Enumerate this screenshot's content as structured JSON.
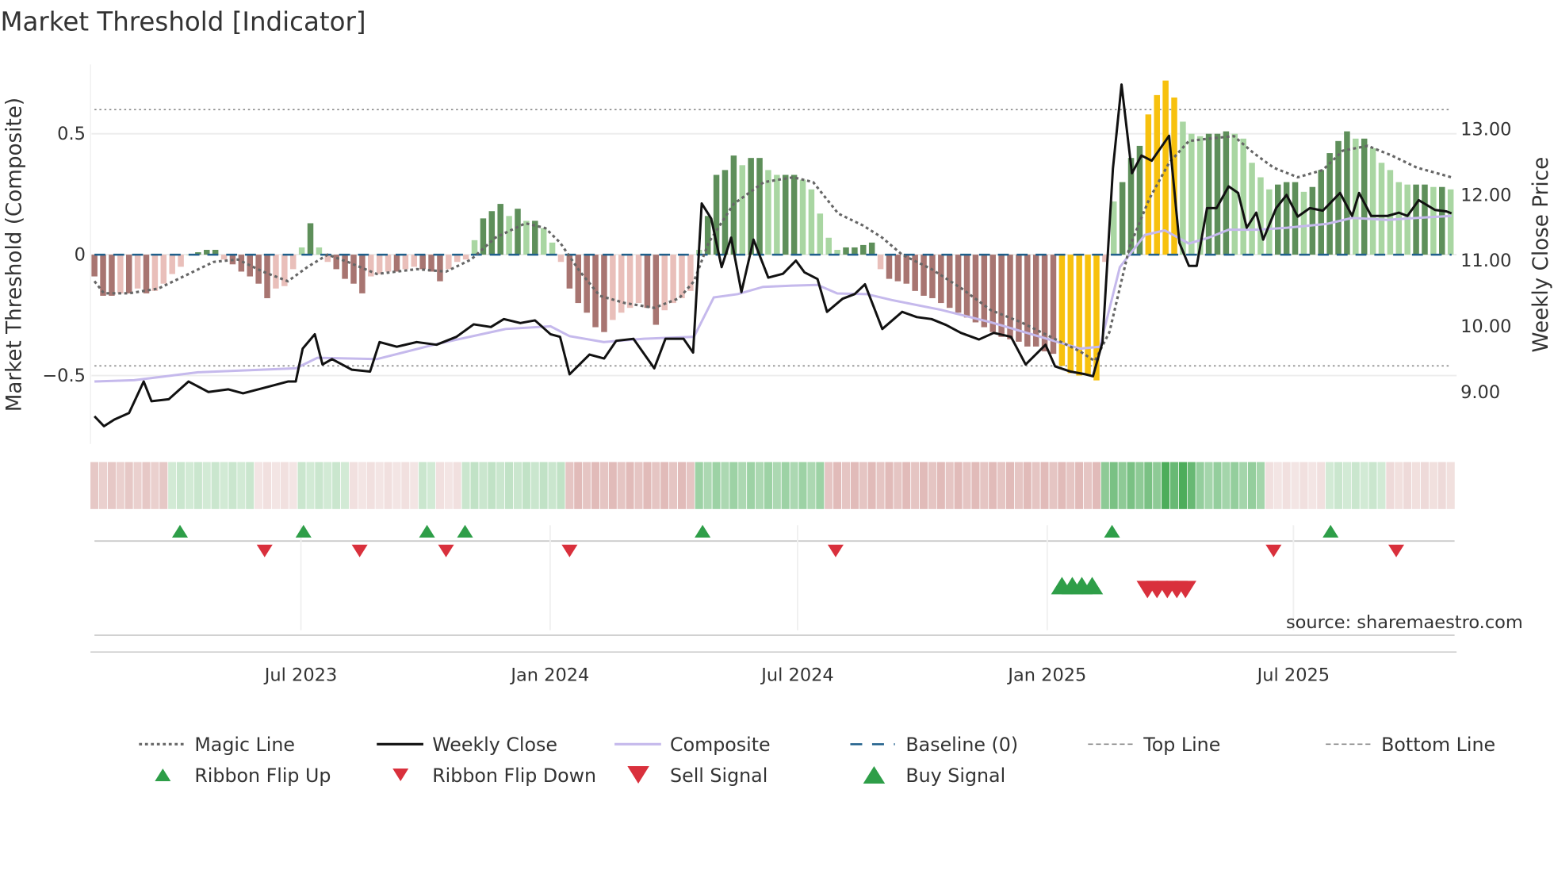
{
  "chart_data": {
    "type": "bar",
    "title": "Market Threshold [Indicator]",
    "ylabel": "Market Threshold (Composite)",
    "ylabel_right": "Weekly Close Price",
    "ylim": [
      -0.78,
      0.78
    ],
    "ylim_right": [
      8.25,
      13.75
    ],
    "xlim_week_index": [
      0,
      157
    ],
    "yticks": [
      {
        "v": 0.5,
        "label": "0.5"
      },
      {
        "v": 0,
        "label": "0"
      },
      {
        "v": -0.5,
        "label": "−0.5"
      }
    ],
    "yticks_right": [
      {
        "v": 13,
        "label": "13.00"
      },
      {
        "v": 12,
        "label": "12.00"
      },
      {
        "v": 11,
        "label": "11.00"
      },
      {
        "v": 10,
        "label": "10.00"
      },
      {
        "v": 9,
        "label": "9.00"
      }
    ],
    "xticks": [
      {
        "w": 23.9,
        "label": "Jul 2023"
      },
      {
        "w": 52.75,
        "label": "Jan 2024"
      },
      {
        "w": 81.4,
        "label": "Jul 2024"
      },
      {
        "w": 110.3,
        "label": "Jan 2025"
      },
      {
        "w": 138.8,
        "label": "Jul 2025"
      }
    ],
    "top_line": 0.6,
    "bottom_line": -0.46,
    "baseline": 0,
    "composite_bars": [
      -0.09,
      -0.17,
      -0.17,
      -0.16,
      -0.16,
      -0.14,
      -0.16,
      -0.15,
      -0.12,
      -0.08,
      -0.05,
      0.0,
      0.01,
      0.02,
      0.02,
      -0.02,
      -0.04,
      -0.07,
      -0.09,
      -0.12,
      -0.18,
      -0.14,
      -0.13,
      -0.06,
      0.03,
      0.13,
      0.03,
      -0.03,
      -0.06,
      -0.1,
      -0.12,
      -0.16,
      -0.09,
      -0.08,
      -0.07,
      -0.07,
      -0.06,
      -0.05,
      -0.06,
      -0.07,
      -0.11,
      -0.06,
      -0.03,
      -0.02,
      0.06,
      0.15,
      0.18,
      0.21,
      0.16,
      0.19,
      0.14,
      0.14,
      0.11,
      0.05,
      -0.03,
      -0.14,
      -0.2,
      -0.24,
      -0.3,
      -0.32,
      -0.27,
      -0.24,
      -0.22,
      -0.2,
      -0.22,
      -0.29,
      -0.23,
      -0.2,
      -0.18,
      -0.15,
      0.02,
      0.16,
      0.33,
      0.35,
      0.41,
      0.37,
      0.4,
      0.4,
      0.35,
      0.33,
      0.33,
      0.33,
      0.31,
      0.27,
      0.17,
      0.07,
      0.02,
      0.03,
      0.03,
      0.04,
      0.05,
      -0.06,
      -0.1,
      -0.11,
      -0.12,
      -0.15,
      -0.17,
      -0.18,
      -0.2,
      -0.22,
      -0.24,
      -0.26,
      -0.28,
      -0.3,
      -0.32,
      -0.34,
      -0.35,
      -0.36,
      -0.38,
      -0.38,
      -0.4,
      -0.41,
      -0.46,
      -0.49,
      -0.5,
      -0.5,
      -0.52,
      -0.03,
      0.22,
      0.3,
      0.4,
      0.45,
      0.58,
      0.66,
      0.72,
      0.65,
      0.55,
      0.5,
      0.49,
      0.5,
      0.5,
      0.51,
      0.5,
      0.48,
      0.38,
      0.32,
      0.27,
      0.29,
      0.3,
      0.3,
      0.26,
      0.28,
      0.35,
      0.42,
      0.47,
      0.51,
      0.48,
      0.48,
      0.44,
      0.38,
      0.35,
      0.3,
      0.29,
      0.29,
      0.29,
      0.28,
      0.28,
      0.27
    ],
    "gold_bars": [
      [
        112,
        116
      ],
      [
        122,
        125
      ]
    ],
    "series": [
      {
        "name": "Magic Line",
        "axis": "left",
        "points": [
          [
            0,
            -0.11
          ],
          [
            1.1,
            -0.16
          ],
          [
            4,
            -0.16
          ],
          [
            7.4,
            -0.14
          ],
          [
            10.3,
            -0.09
          ],
          [
            13.8,
            -0.03
          ],
          [
            16.6,
            -0.02
          ],
          [
            19.5,
            -0.07
          ],
          [
            22.4,
            -0.11
          ],
          [
            24.7,
            -0.05
          ],
          [
            27,
            0
          ],
          [
            29.3,
            -0.03
          ],
          [
            32.7,
            -0.08
          ],
          [
            37.3,
            -0.06
          ],
          [
            40.7,
            -0.07
          ],
          [
            43.6,
            -0.02
          ],
          [
            46.4,
            0.07
          ],
          [
            49.9,
            0.13
          ],
          [
            52.2,
            0.11
          ],
          [
            53.9,
            0.05
          ],
          [
            56.2,
            -0.07
          ],
          [
            58.5,
            -0.17
          ],
          [
            61.4,
            -0.2
          ],
          [
            64.8,
            -0.22
          ],
          [
            67.7,
            -0.18
          ],
          [
            69.4,
            -0.11
          ],
          [
            71.1,
            0.05
          ],
          [
            74,
            0.21
          ],
          [
            77.5,
            0.3
          ],
          [
            80.9,
            0.32
          ],
          [
            83.2,
            0.3
          ],
          [
            86.1,
            0.17
          ],
          [
            89,
            0.12
          ],
          [
            91.2,
            0.07
          ],
          [
            93.5,
            0
          ],
          [
            96.9,
            -0.06
          ],
          [
            100.4,
            -0.14
          ],
          [
            103.8,
            -0.23
          ],
          [
            107.3,
            -0.28
          ],
          [
            110.7,
            -0.34
          ],
          [
            114.1,
            -0.4
          ],
          [
            115.8,
            -0.44
          ],
          [
            117.5,
            -0.32
          ],
          [
            119.8,
            0.03
          ],
          [
            122.1,
            0.23
          ],
          [
            124.4,
            0.38
          ],
          [
            126.7,
            0.47
          ],
          [
            129,
            0.48
          ],
          [
            131.9,
            0.49
          ],
          [
            134.2,
            0.42
          ],
          [
            136.5,
            0.36
          ],
          [
            139.3,
            0.32
          ],
          [
            142.2,
            0.35
          ],
          [
            144.5,
            0.43
          ],
          [
            147.4,
            0.45
          ],
          [
            150.2,
            0.41
          ],
          [
            153.1,
            0.36
          ],
          [
            157.1,
            0.32
          ]
        ]
      },
      {
        "name": "Weekly Close",
        "axis": "right",
        "points": [
          [
            0,
            8.63
          ],
          [
            1.1,
            8.48
          ],
          [
            2.3,
            8.58
          ],
          [
            4,
            8.68
          ],
          [
            5.7,
            9.16
          ],
          [
            6.6,
            8.86
          ],
          [
            8.6,
            8.89
          ],
          [
            10.9,
            9.16
          ],
          [
            13.2,
            9.0
          ],
          [
            15.5,
            9.04
          ],
          [
            17.2,
            8.98
          ],
          [
            20.1,
            9.08
          ],
          [
            22.4,
            9.16
          ],
          [
            23.3,
            9.16
          ],
          [
            24.1,
            9.66
          ],
          [
            25.5,
            9.88
          ],
          [
            26.4,
            9.42
          ],
          [
            27.5,
            9.5
          ],
          [
            29.8,
            9.34
          ],
          [
            31.9,
            9.31
          ],
          [
            33,
            9.76
          ],
          [
            35,
            9.69
          ],
          [
            37.3,
            9.76
          ],
          [
            39.6,
            9.72
          ],
          [
            41.9,
            9.84
          ],
          [
            43.9,
            10.03
          ],
          [
            45.9,
            9.99
          ],
          [
            47.4,
            10.11
          ],
          [
            49.3,
            10.05
          ],
          [
            51,
            10.09
          ],
          [
            52.8,
            9.88
          ],
          [
            53.9,
            9.84
          ],
          [
            55,
            9.27
          ],
          [
            57.3,
            9.57
          ],
          [
            59,
            9.51
          ],
          [
            60.4,
            9.78
          ],
          [
            62.4,
            9.81
          ],
          [
            64.8,
            9.36
          ],
          [
            66.1,
            9.81
          ],
          [
            68.2,
            9.81
          ],
          [
            69.3,
            9.6
          ],
          [
            70.3,
            11.87
          ],
          [
            71.4,
            11.64
          ],
          [
            72.6,
            10.9
          ],
          [
            73.7,
            11.35
          ],
          [
            74.9,
            10.52
          ],
          [
            76.3,
            11.32
          ],
          [
            78,
            10.74
          ],
          [
            79.7,
            10.8
          ],
          [
            81.2,
            11.0
          ],
          [
            82.2,
            10.82
          ],
          [
            83.7,
            10.72
          ],
          [
            84.8,
            10.22
          ],
          [
            86.6,
            10.42
          ],
          [
            88,
            10.49
          ],
          [
            89.2,
            10.64
          ],
          [
            91.2,
            9.96
          ],
          [
            93.5,
            10.22
          ],
          [
            95.2,
            10.14
          ],
          [
            96.9,
            10.11
          ],
          [
            98.6,
            10.02
          ],
          [
            100.3,
            9.9
          ],
          [
            102.4,
            9.8
          ],
          [
            104.1,
            9.9
          ],
          [
            106.1,
            9.84
          ],
          [
            107.8,
            9.42
          ],
          [
            110.1,
            9.72
          ],
          [
            111.2,
            9.39
          ],
          [
            113,
            9.31
          ],
          [
            114.7,
            9.27
          ],
          [
            115.6,
            9.24
          ],
          [
            116.7,
            9.76
          ],
          [
            117.9,
            12.4
          ],
          [
            118.9,
            13.68
          ],
          [
            120.1,
            12.33
          ],
          [
            121.2,
            12.6
          ],
          [
            122.4,
            12.52
          ],
          [
            124.4,
            12.9
          ],
          [
            125.6,
            11.27
          ],
          [
            126.7,
            10.92
          ],
          [
            127.6,
            10.92
          ],
          [
            128.8,
            11.8
          ],
          [
            129.9,
            11.8
          ],
          [
            131.3,
            12.13
          ],
          [
            132.4,
            12.03
          ],
          [
            133.4,
            11.5
          ],
          [
            134.5,
            11.73
          ],
          [
            135.3,
            11.32
          ],
          [
            136.8,
            11.8
          ],
          [
            138,
            12.0
          ],
          [
            139.3,
            11.67
          ],
          [
            140.7,
            11.8
          ],
          [
            142.2,
            11.76
          ],
          [
            144.2,
            12.03
          ],
          [
            145.6,
            11.68
          ],
          [
            146.4,
            12.03
          ],
          [
            147.8,
            11.68
          ],
          [
            149.7,
            11.68
          ],
          [
            151,
            11.73
          ],
          [
            152,
            11.68
          ],
          [
            153.3,
            11.92
          ],
          [
            155.2,
            11.77
          ],
          [
            156.5,
            11.75
          ],
          [
            157.1,
            11.72
          ]
        ]
      },
      {
        "name": "Composite",
        "axis": "right",
        "points": [
          [
            0,
            9.16
          ],
          [
            4.6,
            9.18
          ],
          [
            12,
            9.3
          ],
          [
            23.3,
            9.36
          ],
          [
            25.8,
            9.52
          ],
          [
            32.7,
            9.5
          ],
          [
            39.6,
            9.73
          ],
          [
            47.6,
            9.96
          ],
          [
            52.8,
            10.0
          ],
          [
            55,
            9.85
          ],
          [
            59,
            9.76
          ],
          [
            63.6,
            9.81
          ],
          [
            69.4,
            9.84
          ],
          [
            71.7,
            10.44
          ],
          [
            74.5,
            10.49
          ],
          [
            77.4,
            10.6
          ],
          [
            80.8,
            10.62
          ],
          [
            83.7,
            10.63
          ],
          [
            86,
            10.5
          ],
          [
            89.4,
            10.49
          ],
          [
            92.3,
            10.4
          ],
          [
            98,
            10.25
          ],
          [
            103.8,
            10.06
          ],
          [
            109.5,
            9.84
          ],
          [
            114.1,
            9.66
          ],
          [
            116.4,
            9.69
          ],
          [
            118.7,
            10.9
          ],
          [
            121.6,
            11.39
          ],
          [
            123.9,
            11.46
          ],
          [
            126.7,
            11.26
          ],
          [
            129,
            11.35
          ],
          [
            131.3,
            11.47
          ],
          [
            134.7,
            11.47
          ],
          [
            138.1,
            11.5
          ],
          [
            142.7,
            11.56
          ],
          [
            145.6,
            11.65
          ],
          [
            149.7,
            11.62
          ],
          [
            153.1,
            11.65
          ],
          [
            157.1,
            11.68
          ]
        ]
      }
    ],
    "ribbon_segments": [
      [
        0,
        9,
        -0.45
      ],
      [
        9,
        19,
        0.3
      ],
      [
        19,
        24,
        -0.25
      ],
      [
        24,
        30,
        0.3
      ],
      [
        30,
        38,
        -0.25
      ],
      [
        38,
        40,
        0.3
      ],
      [
        40,
        43,
        -0.25
      ],
      [
        43,
        55,
        0.35
      ],
      [
        55,
        70,
        -0.55
      ],
      [
        70,
        85,
        0.55
      ],
      [
        85,
        117,
        -0.55
      ],
      [
        117,
        124,
        0.75
      ],
      [
        124,
        128,
        1.0
      ],
      [
        128,
        136,
        0.6
      ],
      [
        136,
        143,
        -0.25
      ],
      [
        143,
        150,
        0.3
      ],
      [
        150,
        158,
        -0.3
      ]
    ],
    "ribbon_flip_up": [
      9.9,
      24.2,
      38.5,
      42.9,
      70.4,
      117.8,
      143.1
    ],
    "ribbon_flip_down": [
      19.7,
      30.7,
      40.7,
      55,
      85.8,
      136.5,
      150.7
    ],
    "buy_signals": [
      112,
      113.2,
      114.3,
      115.5
    ],
    "sell_signals": [
      121.9,
      123,
      124.2,
      125.3,
      126.3
    ],
    "legend": [
      {
        "label": "Magic Line",
        "kind": "dotted"
      },
      {
        "label": "Weekly Close",
        "kind": "solid"
      },
      {
        "label": "Composite",
        "kind": "lavender"
      },
      {
        "label": "Baseline (0)",
        "kind": "dashed"
      },
      {
        "label": "Top Line",
        "kind": "thin-dashed"
      },
      {
        "label": "Bottom Line",
        "kind": "thin-dashed"
      },
      {
        "label": "Ribbon Flip Up",
        "kind": "tri-up-small"
      },
      {
        "label": "Ribbon Flip Down",
        "kind": "tri-down-small"
      },
      {
        "label": "Sell Signal",
        "kind": "tri-down-large"
      },
      {
        "label": "Buy Signal",
        "kind": "tri-up-large"
      }
    ],
    "legend_placement": "bottom",
    "source": "source: sharemaestro.com",
    "colors": {
      "neg_dark": "#a87571",
      "neg_light": "#e9bfba",
      "pos_dark": "#5e8f5a",
      "pos_light": "#a9d6a2",
      "gold": "#f7c10e",
      "close": "#111111",
      "composite": "#c5b9ec",
      "magic": "#666666",
      "baseline": "#1f5f8b",
      "buy": "#2e9e48",
      "sell": "#d9303c"
    }
  }
}
